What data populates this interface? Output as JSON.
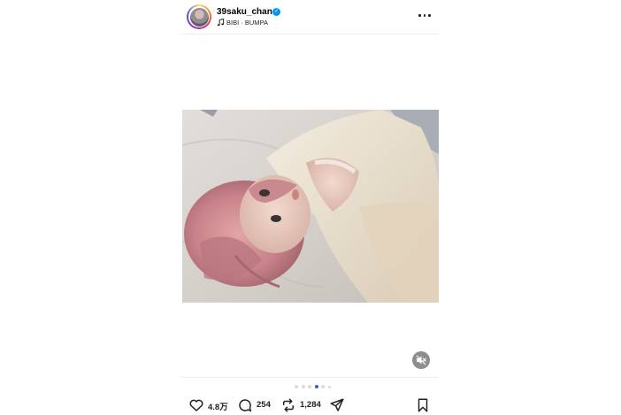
{
  "header": {
    "username": "39saku_chan",
    "verified": true,
    "music": "BIBI · BUMPA",
    "avatar_icon": "profile-avatar",
    "more_icon": "more-options-icon"
  },
  "media": {
    "photo_description": "selfie",
    "carousel": {
      "total": 6,
      "active": 4
    },
    "mute_icon": "speaker-muted-icon"
  },
  "actions": {
    "likes": "4.8万",
    "comments": "254",
    "reposts": "1,284"
  },
  "colors": {
    "verified": "#0095f6",
    "active_dot": "#3b5bdb",
    "inactive_dot": "#dbdbdb",
    "icon": "#222222"
  }
}
